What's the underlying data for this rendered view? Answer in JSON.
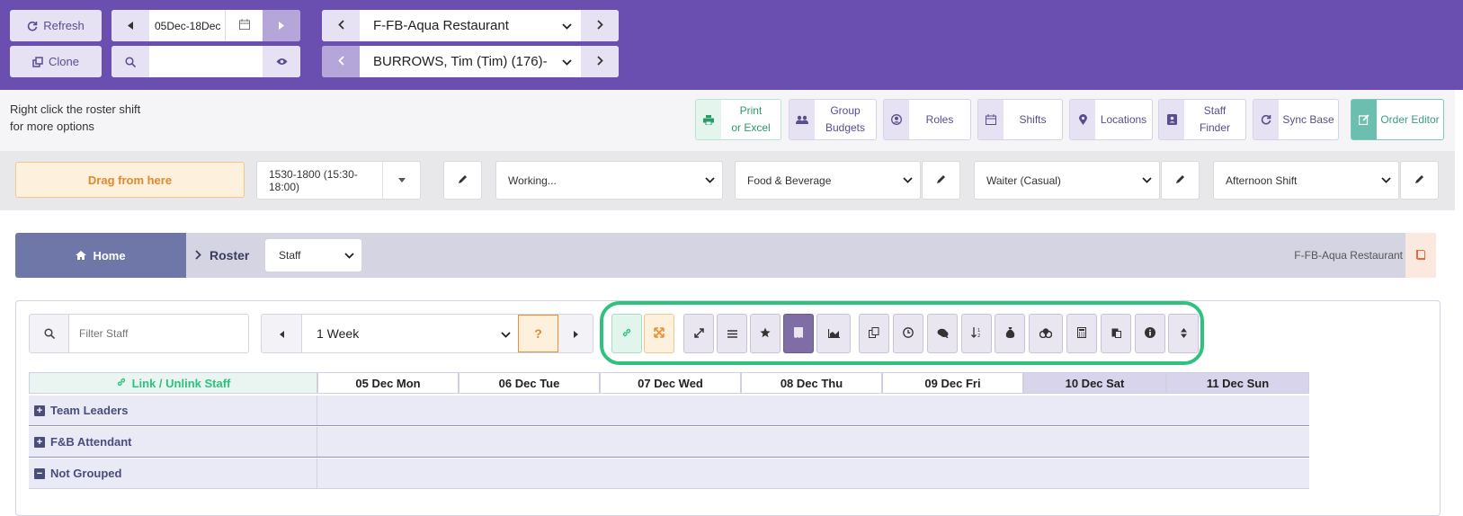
{
  "topbar": {
    "refresh_label": "Refresh",
    "clone_label": "Clone",
    "date_range": "05Dec-18Dec",
    "search_value": "",
    "location_select": "F-FB-Aqua Restaurant",
    "staff_select": "BURROWS, Tim (Tim) (176)-"
  },
  "hint": {
    "line1": "Right click the roster shift",
    "line2": "for more options"
  },
  "tools": {
    "print_line1": "Print",
    "print_line2": "or Excel",
    "group_line1": "Group",
    "group_line2": "Budgets",
    "roles": "Roles",
    "shifts": "Shifts",
    "locations": "Locations",
    "staff_finder": "Staff Finder",
    "sync_base": "Sync Base",
    "order_editor": "Order Editor"
  },
  "fields": {
    "drag_label": "Drag from here",
    "time_value": "1530-1800 (15:30-18:00)",
    "status_value": "Working...",
    "department_value": "Food & Beverage",
    "role_value": "Waiter (Casual)",
    "shift_value": "Afternoon Shift"
  },
  "breadcrumb": {
    "home": "Home",
    "roster": "Roster",
    "view_select": "Staff",
    "location_text": "F-FB-Aqua Restaurant"
  },
  "roster": {
    "filter_placeholder": "Filter Staff",
    "period_select": "1 Week",
    "help_label": "?",
    "link_header": "Link / Unlink Staff",
    "days": [
      "05 Dec Mon",
      "06 Dec Tue",
      "07 Dec Wed",
      "08 Dec Thu",
      "09 Dec Fri",
      "10 Dec Sat",
      "11 Dec Sun"
    ],
    "groups": [
      {
        "name": "Team Leaders",
        "toggle": "+"
      },
      {
        "name": "F&B Attendant",
        "toggle": "+"
      },
      {
        "name": "Not Grouped",
        "toggle": "−"
      }
    ]
  },
  "colors": {
    "topbar": "#6a4fb1",
    "accent_green": "#2ec27e",
    "drag_orange": "#e8913a",
    "home_bg": "#6e77a8"
  }
}
